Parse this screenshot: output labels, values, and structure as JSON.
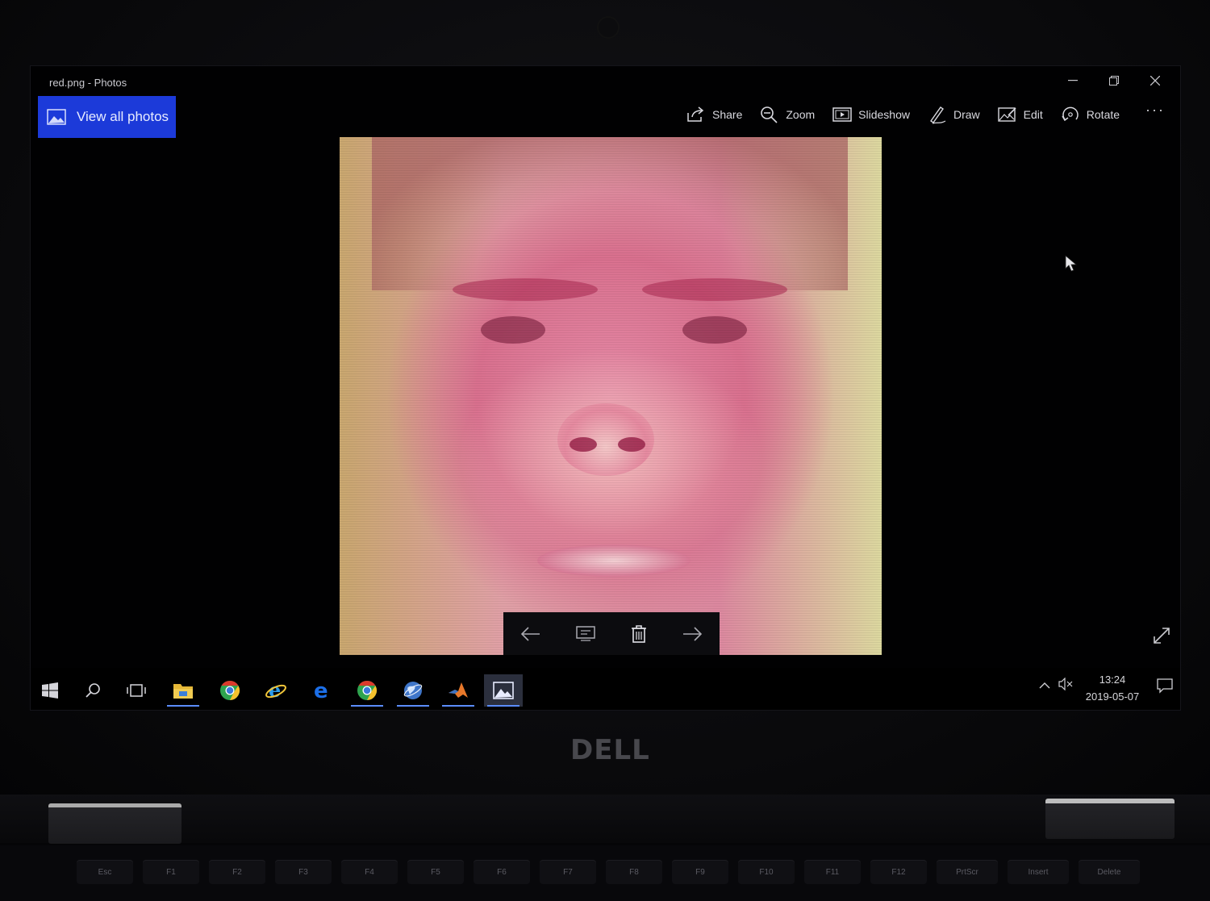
{
  "window": {
    "title": "red.png - Photos",
    "controls": {
      "minimize": "–",
      "restore": "❐",
      "close": "✕"
    }
  },
  "view_all": {
    "label": "View all photos",
    "icon": "photos-icon"
  },
  "toolbar": {
    "share": "Share",
    "zoom": "Zoom",
    "slideshow": "Slideshow",
    "draw": "Draw",
    "edit": "Edit",
    "rotate": "Rotate",
    "more": "···"
  },
  "photo": {
    "description_icon": "face-photo",
    "tint": "#dc889f"
  },
  "photo_controls": [
    "previous-arrow-icon",
    "image-info-icon",
    "delete-icon",
    "next-arrow-icon"
  ],
  "taskbar": {
    "items": [
      "windows-start",
      "search",
      "task-view",
      "file-explorer",
      "chrome",
      "internet-explorer",
      "edge",
      "chrome",
      "network-globe",
      "matlab",
      "photos"
    ],
    "tray": {
      "chevron": "^",
      "volume": "🔇︎"
    },
    "clock": {
      "time": "13:24",
      "date": "2019-05-07"
    }
  },
  "laptop": {
    "brand": "DELL",
    "keys": [
      "Esc",
      "F1",
      "F2",
      "F3",
      "F4",
      "F5",
      "F6",
      "F7",
      "F8",
      "F9",
      "F10",
      "F11",
      "F12",
      "PrtScr",
      "Insert",
      "Delete"
    ]
  },
  "colors": {
    "accent": "#1c3ad9",
    "taskbar_indicator": "#5b8cff"
  }
}
